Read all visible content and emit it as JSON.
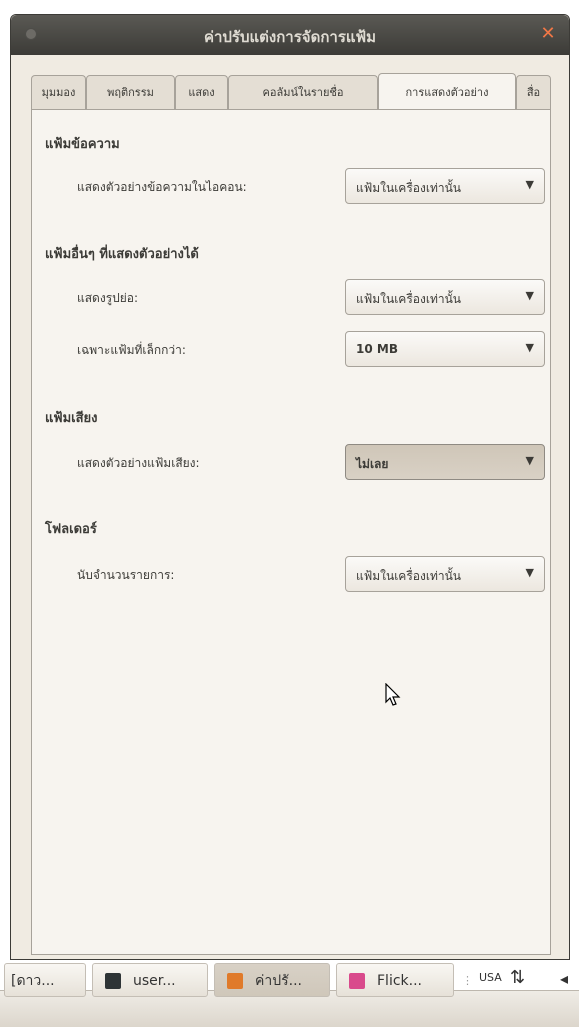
{
  "window": {
    "title": "ค่าปรับแต่งการจัดการแฟ้ม",
    "close": "✕"
  },
  "tabs": [
    {
      "label": "มุมมอง"
    },
    {
      "label": "พฤติกรรม"
    },
    {
      "label": "แสดง"
    },
    {
      "label": "คอลัมน์ในรายชื่อ"
    },
    {
      "label": "การแสดงตัวอย่าง",
      "active": true
    },
    {
      "label": "สื่อ"
    }
  ],
  "sections": {
    "text_files": {
      "title": "แฟ้มข้อความ",
      "label": "แสดงตัวอย่างข้อความในไอคอน:",
      "value": "แฟ้มในเครื่องเท่านั้น"
    },
    "other_previewable": {
      "title": "แฟ้มอื่นๆ ที่แสดงตัวอย่างได้",
      "thumb_label": "แสดงรูปย่อ:",
      "thumb_value": "แฟ้มในเครื่องเท่านั้น",
      "size_label": "เฉพาะแฟ้มที่เล็กกว่า:",
      "size_value": "10 MB"
    },
    "sound_files": {
      "title": "แฟ้มเสียง",
      "label": "แสดงตัวอย่างแฟ้มเสียง:",
      "value": "ไม่เลย"
    },
    "folders": {
      "title": "โฟลเดอร์",
      "label": "นับจำนวนรายการ:",
      "value": "แฟ้มในเครื่องเท่านั้น"
    }
  },
  "dropdown_arrow": "▼",
  "taskbar": {
    "items": [
      {
        "label": "[ดาว...",
        "icon": "download-icon"
      },
      {
        "label": "user...",
        "icon": "terminal-icon"
      },
      {
        "label": "ค่าปรั...",
        "icon": "preferences-icon"
      },
      {
        "label": "Flick...",
        "icon": "photo-app-icon"
      }
    ],
    "keyboard_layout": "USA",
    "colors": {
      "terminal": "#2e3436",
      "preferences": "#e07a2a",
      "photo": "#d94a8c"
    }
  }
}
